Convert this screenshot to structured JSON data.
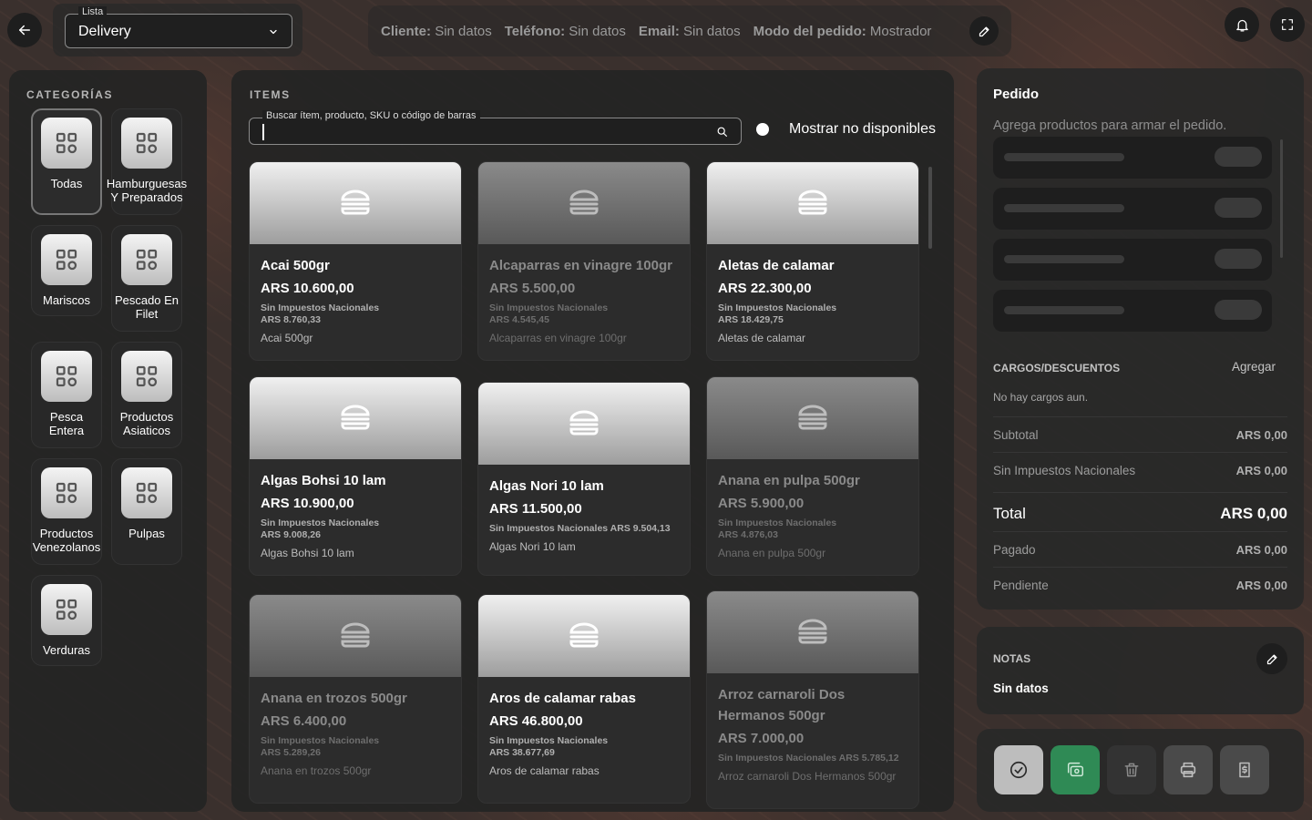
{
  "top": {
    "list_legend": "Lista",
    "list_value": "Delivery",
    "info": [
      {
        "key": "Cliente:",
        "value": "Sin datos"
      },
      {
        "key": "Teléfono:",
        "value": "Sin datos"
      },
      {
        "key": "Email:",
        "value": "Sin datos"
      },
      {
        "key": "Modo del pedido:",
        "value": "Mostrador"
      }
    ],
    "icons": [
      "arrow-left-icon",
      "chevron-down-icon",
      "pencil-icon",
      "bell-icon",
      "fullscreen-icon"
    ]
  },
  "categories": {
    "title": "CATEGORÍAS",
    "items": [
      {
        "label": "Todas",
        "active": true
      },
      {
        "label": "Hamburguesas Y Preparados",
        "active": false
      },
      {
        "label": "Mariscos",
        "active": false
      },
      {
        "label": "Pescado En Filet",
        "active": false
      },
      {
        "label": "Pesca Entera",
        "active": false
      },
      {
        "label": "Productos Asiaticos",
        "active": false
      },
      {
        "label": "Productos Venezolanos",
        "active": false
      },
      {
        "label": "Pulpas",
        "active": false
      },
      {
        "label": "Verduras",
        "active": false
      }
    ]
  },
  "items": {
    "title": "ITEMS",
    "search_legend": "Buscar ítem, producto, SKU o código de barras",
    "search_value": "",
    "toggle_label": "Mostrar no disponibles",
    "products": [
      {
        "name": "Acai 500gr",
        "price": "ARS 10.600,00",
        "tax": "Sin Impuestos Nacionales ARS 8.760,33",
        "desc": "Acai 500gr",
        "available": true
      },
      {
        "name": "Alcaparras en vinagre 100gr",
        "price": "ARS 5.500,00",
        "tax": "Sin Impuestos Nacionales ARS 4.545,45",
        "desc": "Alcaparras en vinagre 100gr",
        "available": false
      },
      {
        "name": "Aletas de calamar",
        "price": "ARS 22.300,00",
        "tax": "Sin Impuestos Nacionales ARS 18.429,75",
        "desc": "Aletas de calamar",
        "available": true
      },
      {
        "name": "Algas Bohsi 10 lam",
        "price": "ARS 10.900,00",
        "tax": "Sin Impuestos Nacionales ARS 9.008,26",
        "desc": "Algas Bohsi 10 lam",
        "available": true
      },
      {
        "name": "Algas Nori 10 lam",
        "price": "ARS 11.500,00",
        "tax": "Sin Impuestos Nacionales ARS 9.504,13",
        "desc": "Algas Nori 10 lam",
        "available": true
      },
      {
        "name": "Anana en pulpa 500gr",
        "price": "ARS 5.900,00",
        "tax": "Sin Impuestos Nacionales ARS 4.876,03",
        "desc": "Anana en pulpa 500gr",
        "available": false
      },
      {
        "name": "Anana en trozos 500gr",
        "price": "ARS 6.400,00",
        "tax": "Sin Impuestos Nacionales ARS 5.289,26",
        "desc": "Anana en trozos 500gr",
        "available": false
      },
      {
        "name": "Aros de calamar rabas",
        "price": "ARS 46.800,00",
        "tax": "Sin Impuestos Nacionales ARS 38.677,69",
        "desc": "Aros de calamar rabas",
        "available": true
      },
      {
        "name": "Arroz carnaroli Dos Hermanos 500gr",
        "price": "ARS 7.000,00",
        "tax": "Sin Impuestos Nacionales ARS 5.785,12",
        "desc": "Arroz carnaroli Dos Hermanos 500gr",
        "available": false
      }
    ]
  },
  "order": {
    "title": "Pedido",
    "hint": "Agrega productos para armar el pedido.",
    "charges_title": "CARGOS/DESCUENTOS",
    "charges_add": "Agregar",
    "charges_empty": "No hay cargos aun.",
    "rows": [
      {
        "label": "Subtotal",
        "value": "ARS 0,00"
      },
      {
        "label": "Sin Impuestos Nacionales",
        "value": "ARS 0,00"
      },
      {
        "label": "Total",
        "value": "ARS 0,00"
      },
      {
        "label": "Pagado",
        "value": "ARS 0,00"
      },
      {
        "label": "Pendiente",
        "value": "ARS 0,00"
      }
    ]
  },
  "notes": {
    "title": "NOTAS",
    "value": "Sin datos"
  },
  "actions": [
    {
      "icon": "check-circle-icon",
      "color": "#bdbdbd"
    },
    {
      "icon": "copy-icon",
      "color": "#2f8a55"
    },
    {
      "icon": "trash-icon",
      "color": "#333333"
    },
    {
      "icon": "printer-icon",
      "color": "#4a4a4a"
    },
    {
      "icon": "receipt-icon",
      "color": "#4a4a4a"
    }
  ]
}
